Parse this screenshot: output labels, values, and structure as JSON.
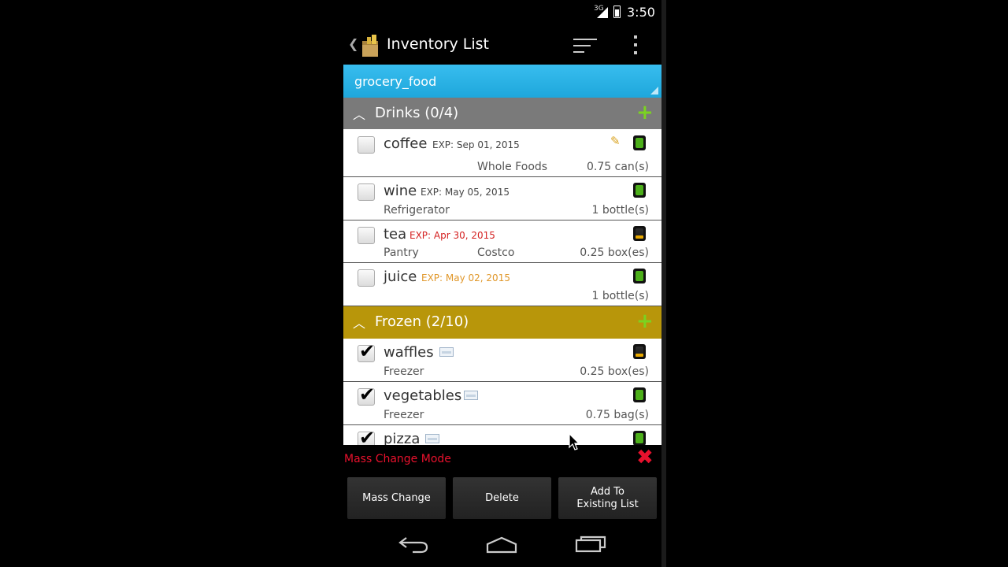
{
  "status_bar": {
    "time": "3:50",
    "network": "3G"
  },
  "app_bar": {
    "title": "Inventory List"
  },
  "list_selector": {
    "label": "grocery_food"
  },
  "categories": [
    {
      "name": "Drinks (0/4)",
      "color": "#7a7a7a",
      "items": [
        {
          "name": "coffee",
          "exp": "EXP: Sep 01, 2015",
          "exp_color": "#444444",
          "location": "",
          "store": "Whole Foods",
          "qty": "0.75 can(s)",
          "checked": false,
          "level": "green",
          "note_icon": true
        },
        {
          "name": "wine",
          "exp": "EXP: May 05, 2015",
          "exp_color": "#444444",
          "location": "Refrigerator",
          "store": "",
          "qty": "1 bottle(s)",
          "checked": false,
          "level": "green"
        },
        {
          "name": "tea",
          "exp": "EXP: Apr 30, 2015",
          "exp_color": "#d42020",
          "location": "Pantry",
          "store": "Costco",
          "qty": "0.25 box(es)",
          "checked": false,
          "level": "dark"
        },
        {
          "name": "juice",
          "exp": "EXP: May 02, 2015",
          "exp_color": "#e0972a",
          "location": "",
          "store": "",
          "qty": "1 bottle(s)",
          "checked": false,
          "level": "green"
        }
      ]
    },
    {
      "name": "Frozen (2/10)",
      "color": "#b8960a",
      "items": [
        {
          "name": "waffles",
          "location": "Freezer",
          "qty": "0.25 box(es)",
          "checked": true,
          "level": "dark",
          "calendar_icon": true
        },
        {
          "name": "vegetables",
          "location": "Freezer",
          "qty": "0.75 bag(s)",
          "checked": true,
          "level": "green",
          "calendar_icon": true
        },
        {
          "name": "pizza",
          "location": "",
          "qty": "",
          "checked": true,
          "level": "green",
          "calendar_icon": true
        }
      ]
    }
  ],
  "mass_change": {
    "label": "Mass Change Mode",
    "close_icon": "close-x-icon"
  },
  "buttons": {
    "mass_change": "Mass Change",
    "delete": "Delete",
    "add_to_existing": "Add To Existing List"
  },
  "nav": {
    "back": "back-icon",
    "home": "home-icon",
    "recents": "recents-icon"
  }
}
